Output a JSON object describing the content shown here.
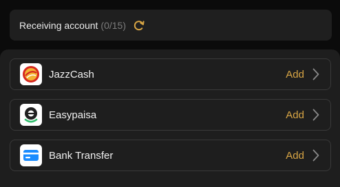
{
  "header": {
    "title": "Receiving account",
    "count": "(0/15)",
    "refresh_icon": "refresh-icon"
  },
  "accounts": [
    {
      "name": "JazzCash",
      "action": "Add",
      "icon": "jazzcash-logo"
    },
    {
      "name": "Easypaisa",
      "action": "Add",
      "icon": "easypaisa-logo"
    },
    {
      "name": "Bank Transfer",
      "action": "Add",
      "icon": "bank-card-icon"
    }
  ],
  "colors": {
    "accent": "#d9a645",
    "background": "#0b0b0b",
    "panel": "#1e1e1e",
    "card_blue": "#1a8cff",
    "easypaisa_green": "#2ebd6b",
    "jazzcash_red": "#d6281f"
  }
}
